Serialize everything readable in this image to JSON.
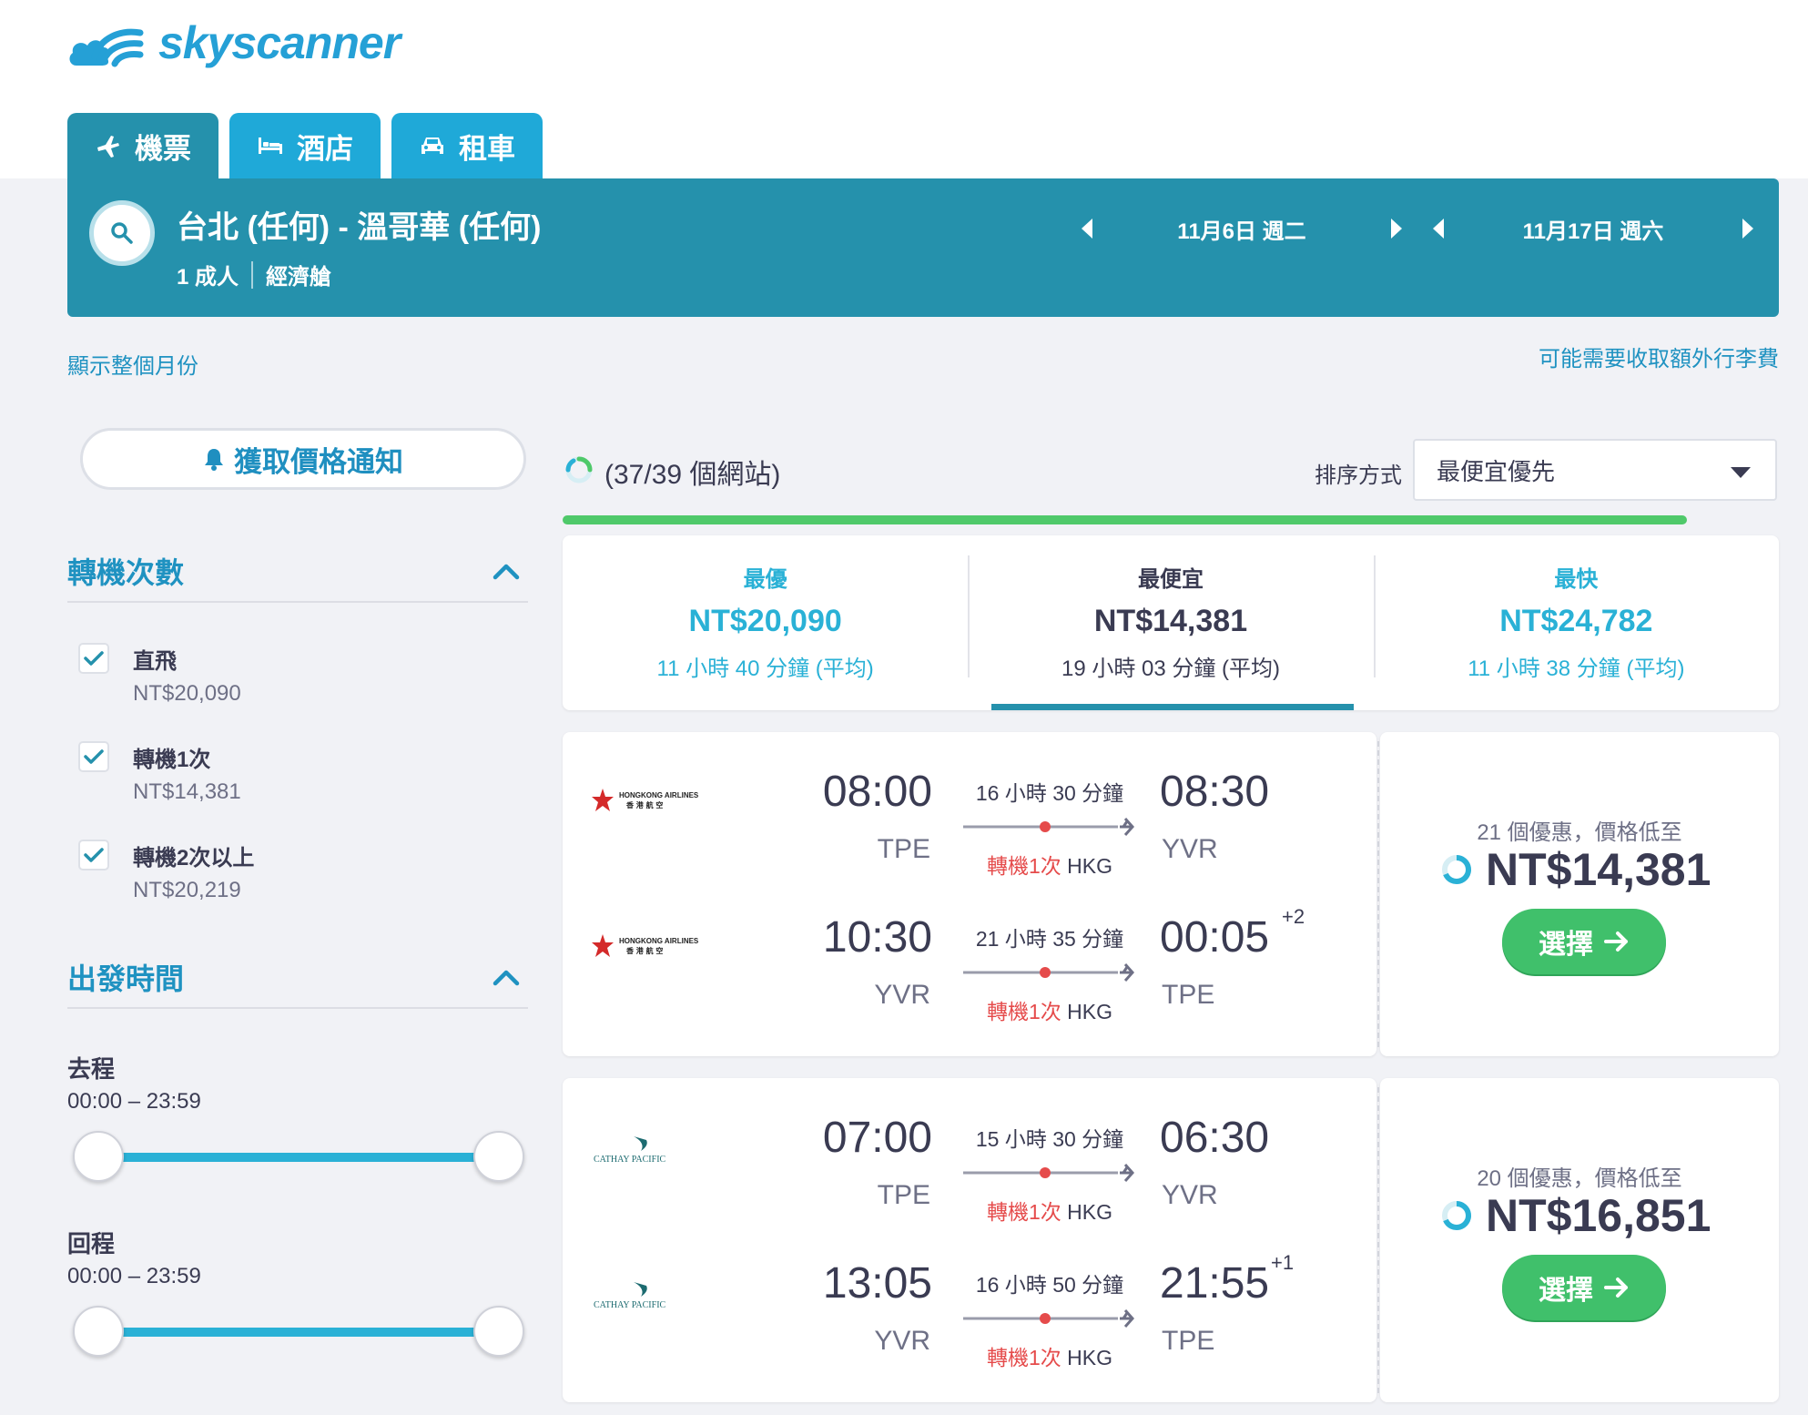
{
  "brand": {
    "name": "skyscanner",
    "color": "#25a0d6"
  },
  "nav_tabs": [
    {
      "label": "機票",
      "icon": "plane-icon",
      "active": true
    },
    {
      "label": "酒店",
      "icon": "bed-icon",
      "active": false
    },
    {
      "label": "租車",
      "icon": "car-icon",
      "active": false
    }
  ],
  "search": {
    "route": "台北 (任何) - 溫哥華 (任何)",
    "passengers": "1 成人",
    "cabin": "經濟艙",
    "depart_date": "11月6日 週二",
    "return_date": "11月17日 週六"
  },
  "links": {
    "show_month": "顯示整個月份",
    "bag_fees": "可能需要收取額外行李費"
  },
  "sidebar": {
    "alert_button": "獲取價格通知",
    "stops_title": "轉機次數",
    "stops": [
      {
        "label": "直飛",
        "price": "NT$20,090",
        "checked": true
      },
      {
        "label": "轉機1次",
        "price": "NT$14,381",
        "checked": true
      },
      {
        "label": "轉機2次以上",
        "price": "NT$20,219",
        "checked": true
      }
    ],
    "departure_title": "出發時間",
    "outbound_label": "去程",
    "outbound_range": "00:00 – 23:59",
    "return_label": "回程",
    "return_range": "00:00 – 23:59"
  },
  "results_header": {
    "sites_count": "(37/39 個網站)",
    "sort_label": "排序方式",
    "sort_value": "最便宜優先",
    "progress_fraction": 0.95
  },
  "summary": [
    {
      "heading": "最優",
      "price": "NT$20,090",
      "duration": "11 小時 40 分鐘 (平均)",
      "active": false
    },
    {
      "heading": "最便宜",
      "price": "NT$14,381",
      "duration": "19 小時 03 分鐘 (平均)",
      "active": true
    },
    {
      "heading": "最快",
      "price": "NT$24,782",
      "duration": "11 小時 38 分鐘 (平均)",
      "active": false
    }
  ],
  "itineraries": [
    {
      "airline": "Hong Kong Airlines",
      "legs": [
        {
          "dep_time": "08:00",
          "dep_code": "TPE",
          "duration": "16 小時 30 分鐘",
          "arr_time": "08:30",
          "arr_code": "YVR",
          "plus": "",
          "stop_text": "轉機1次",
          "stop_city": "HKG"
        },
        {
          "dep_time": "10:30",
          "dep_code": "YVR",
          "duration": "21 小時 35 分鐘",
          "arr_time": "00:05",
          "arr_code": "TPE",
          "plus": "+2",
          "stop_text": "轉機1次",
          "stop_city": "HKG"
        }
      ],
      "deals": "21 個優惠，價格低至",
      "price": "NT$14,381",
      "select_label": "選擇"
    },
    {
      "airline": "Cathay Pacific",
      "legs": [
        {
          "dep_time": "07:00",
          "dep_code": "TPE",
          "duration": "15 小時 30 分鐘",
          "arr_time": "06:30",
          "arr_code": "YVR",
          "plus": "",
          "stop_text": "轉機1次",
          "stop_city": "HKG"
        },
        {
          "dep_time": "13:05",
          "dep_code": "YVR",
          "duration": "16 小時 50 分鐘",
          "arr_time": "21:55",
          "arr_code": "TPE",
          "plus": "+1",
          "stop_text": "轉機1次",
          "stop_city": "HKG"
        }
      ],
      "deals": "20 個優惠，價格低至",
      "price": "NT$16,851",
      "select_label": "選擇"
    }
  ],
  "airline_logos": {
    "hk_line1": "HONGKONG AIRLINES",
    "hk_line2": "香 港 航 空",
    "cx": "CATHAY PACIFIC"
  }
}
